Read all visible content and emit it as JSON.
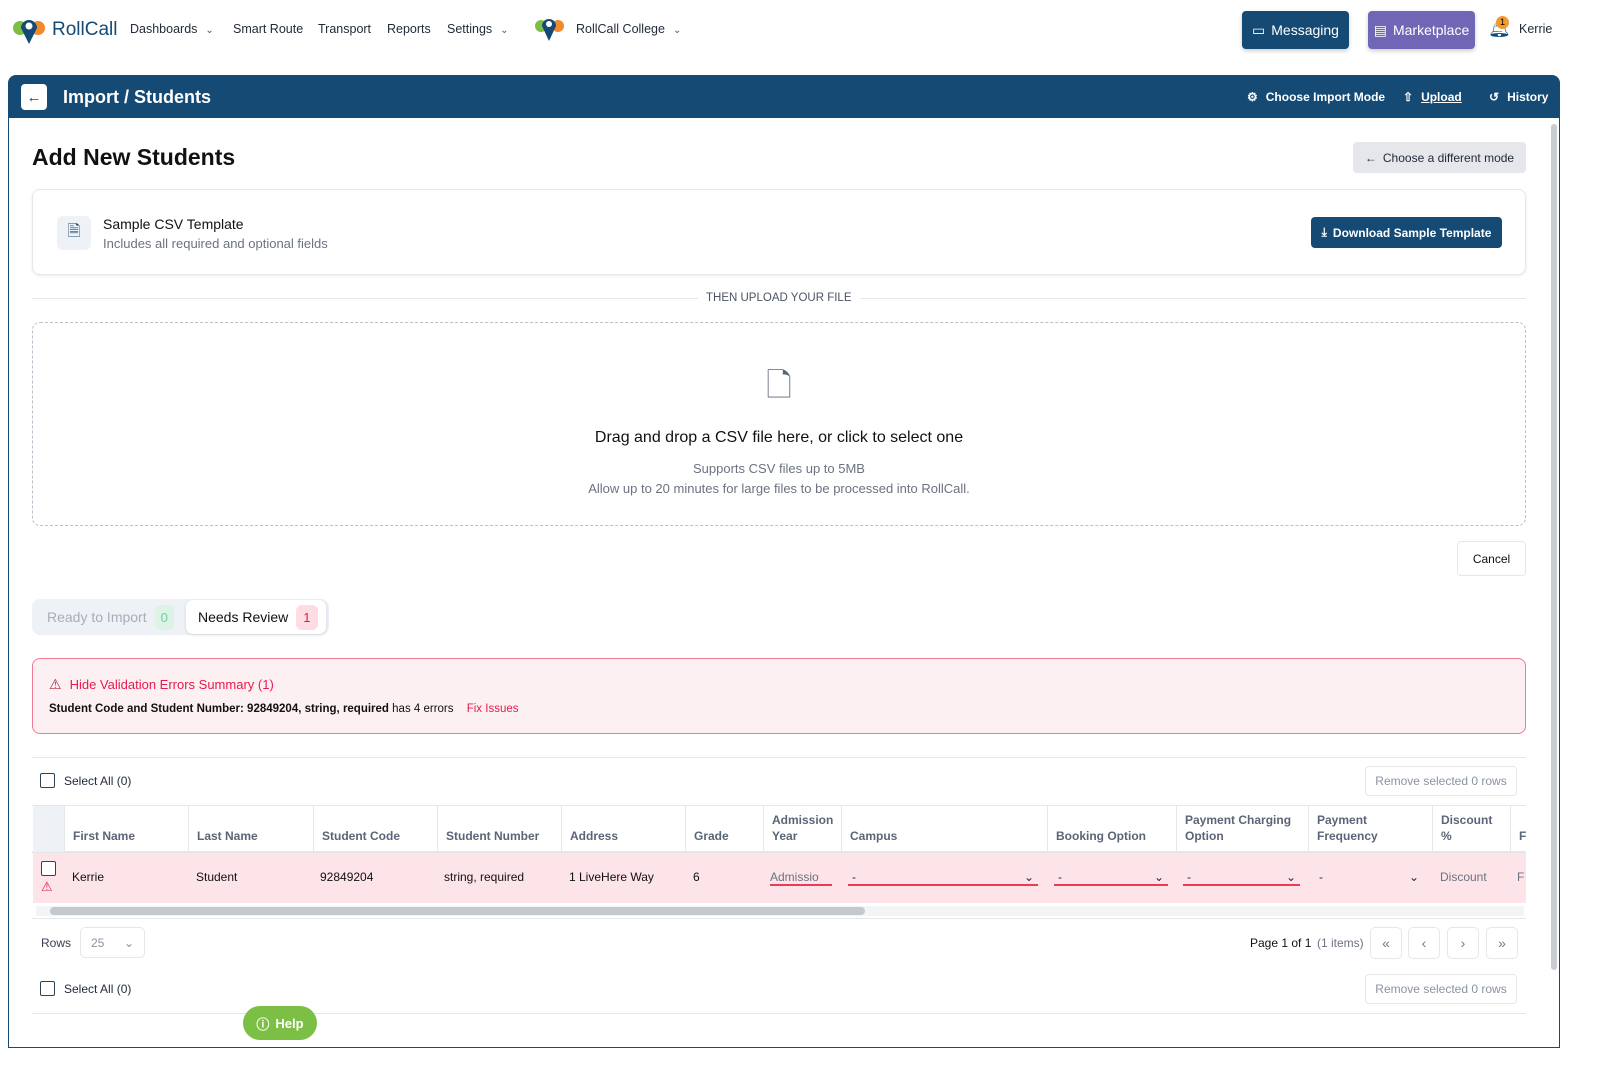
{
  "nav": {
    "brand": "RollCall",
    "items": [
      {
        "label": "Dashboards",
        "dropdown": true
      },
      {
        "label": "Smart Route"
      },
      {
        "label": "Transport"
      },
      {
        "label": "Reports"
      },
      {
        "label": "Settings",
        "dropdown": true
      }
    ],
    "org": "RollCall College",
    "messaging": "Messaging",
    "marketplace": "Marketplace",
    "notifications": "1",
    "user": "Kerrie"
  },
  "header": {
    "title": "Import / Students",
    "choose_mode": "Choose Import Mode",
    "upload": "Upload",
    "history": "History"
  },
  "page": {
    "title": "Add New Students",
    "different_mode": "Choose a different mode"
  },
  "template": {
    "title": "Sample CSV Template",
    "subtitle": "Includes all required and optional fields",
    "download": "Download Sample Template"
  },
  "divider": "THEN UPLOAD YOUR FILE",
  "dropzone": {
    "title": "Drag and drop a CSV file here, or click to select one",
    "line1": "Supports CSV files up to 5MB",
    "line2": "Allow up to 20 minutes for large files to be processed into RollCall."
  },
  "cancel": "Cancel",
  "tabs": [
    {
      "label": "Ready to Import",
      "count": "0"
    },
    {
      "label": "Needs Review",
      "count": "1"
    }
  ],
  "errors": {
    "toggle": "Hide Validation Errors Summary (1)",
    "bold": "Student Code and Student Number: 92849204, string, required",
    "rest": "has 4 errors",
    "fix": "Fix Issues"
  },
  "table": {
    "select_all": "Select All (0)",
    "remove": "Remove selected 0 rows",
    "columns": [
      "First Name",
      "Last Name",
      "Student Code",
      "Student Number",
      "Address",
      "Grade",
      "Admission Year",
      "Campus",
      "Booking Option",
      "Payment Charging Option",
      "Payment Frequency",
      "Discount %",
      "F"
    ],
    "row": {
      "first": "Kerrie",
      "last": "Student",
      "code": "92849204",
      "number": "string, required",
      "address": "1 LiveHere Way",
      "grade": "6",
      "admission": "Admissio",
      "campus": "-",
      "booking": "-",
      "charging": "-",
      "frequency": "-",
      "discount": "Discount",
      "f": "F"
    },
    "rows_label": "Rows",
    "rows_value": "25",
    "page_info": "Page 1 of 1",
    "items": "(1 items)"
  },
  "help": "Help",
  "colors": {
    "primary": "#154a75",
    "purple": "#6f66b6",
    "error": "#e8194d"
  }
}
